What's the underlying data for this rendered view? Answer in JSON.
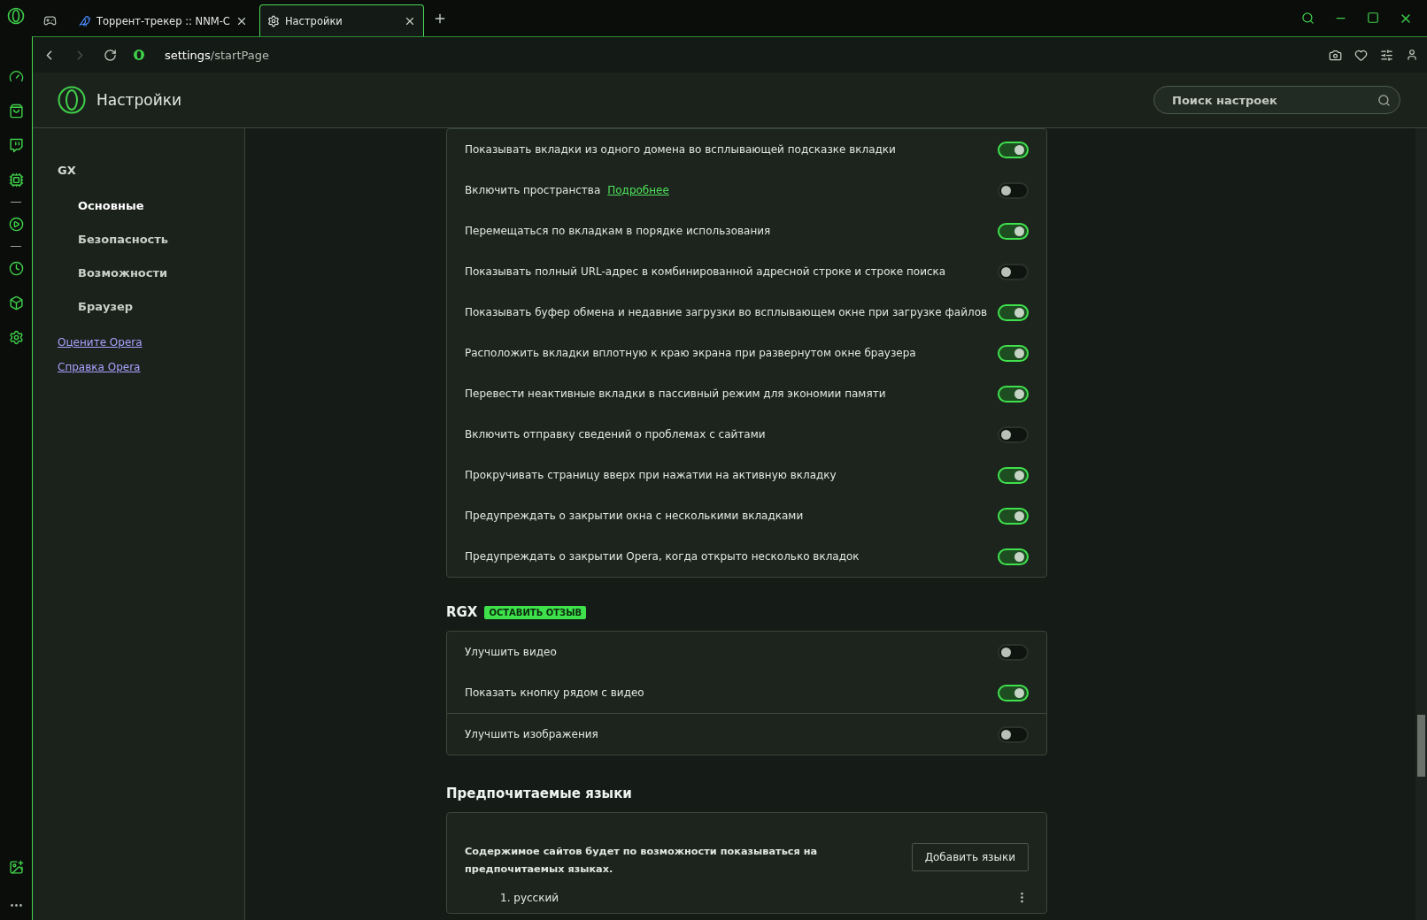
{
  "tabs": [
    {
      "kind": "icon",
      "selected": false
    },
    {
      "kind": "page",
      "label": "Торрент-трекер :: NNM-C",
      "selected": false
    },
    {
      "kind": "page",
      "label": "Настройки",
      "selected": true
    }
  ],
  "address_bar": {
    "host": "settings",
    "path": "/startPage"
  },
  "header": {
    "title": "Настройки",
    "search": {
      "placeholder": "Поиск настроек"
    }
  },
  "nav": {
    "section": "GX",
    "items": [
      {
        "label": "Основные",
        "selected": true
      },
      {
        "label": "Безопасность",
        "selected": false
      },
      {
        "label": "Возможности",
        "selected": false
      },
      {
        "label": "Браузер",
        "selected": false
      }
    ],
    "links": [
      "Оцените Opera",
      "Справка Opera"
    ]
  },
  "tab_settings": [
    {
      "label": "Показывать вкладки из одного домена во всплывающей подсказке вкладки",
      "on": true
    },
    {
      "label": "Включить пространства",
      "link": "Подробнее",
      "on": false
    },
    {
      "label": "Перемещаться по вкладкам в порядке использования",
      "on": true
    },
    {
      "label": "Показывать полный URL-адрес в комбинированной адресной строке и строке поиска",
      "on": false
    },
    {
      "label": "Показывать буфер обмена и недавние загрузки во всплывающем окне при загрузке файлов",
      "on": true
    },
    {
      "label": "Расположить вкладки вплотную к краю экрана при развернутом окне браузера",
      "on": true
    },
    {
      "label": "Перевести неактивные вкладки в пассивный режим для экономии памяти",
      "on": true
    },
    {
      "label": "Включить отправку сведений о проблемах с сайтами",
      "on": false
    },
    {
      "label": "Прокручивать страницу вверх при нажатии на активную вкладку",
      "on": true
    },
    {
      "label": "Предупреждать о закрытии окна с несколькими вкладками",
      "on": true
    },
    {
      "label": "Предупреждать о закрытии Opera, когда открыто несколько вкладок",
      "on": true
    }
  ],
  "rgx": {
    "title": "RGX",
    "badge": "ОСТАВИТЬ ОТЗЫВ",
    "groups": [
      [
        {
          "label": "Улучшить видео",
          "on": false
        },
        {
          "label": "Показать кнопку рядом с видео",
          "on": true
        }
      ],
      [
        {
          "label": "Улучшить изображения",
          "on": false
        }
      ]
    ]
  },
  "languages": {
    "title": "Предпочитаемые языки",
    "description": "Содержимое сайтов будет по возможности показываться на предпочитаемых языках.",
    "button": "Добавить языки",
    "items": [
      "1. русский"
    ]
  }
}
